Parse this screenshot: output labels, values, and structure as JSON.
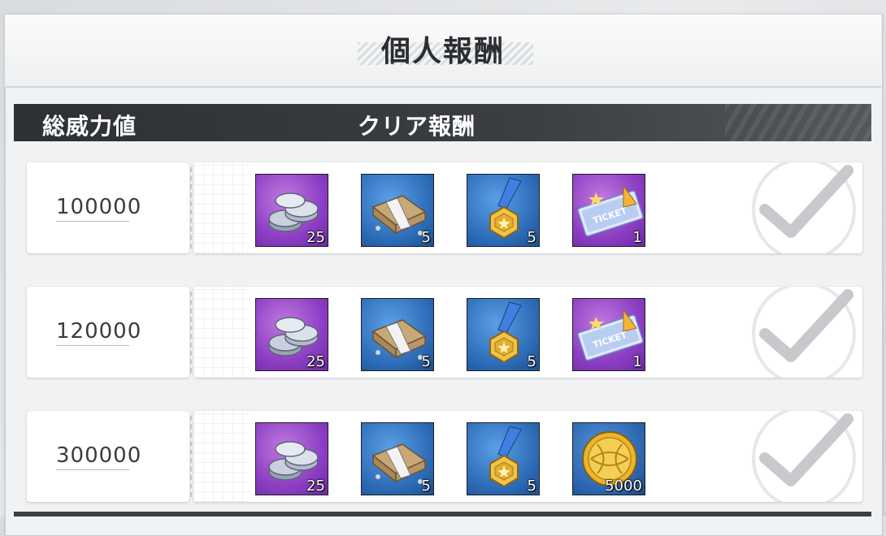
{
  "title": "個人報酬",
  "header": {
    "power_label": "総威力値",
    "reward_label": "クリア報酬"
  },
  "rows": [
    {
      "power": "100000",
      "rewards": [
        {
          "icon": "silver-coins-icon",
          "qty": "25",
          "bg": "purple"
        },
        {
          "icon": "cash-bundle-icon",
          "qty": "5",
          "bg": "blue"
        },
        {
          "icon": "gold-medal-icon",
          "qty": "5",
          "bg": "blue"
        },
        {
          "icon": "ticket-icon",
          "qty": "1",
          "bg": "purple"
        }
      ],
      "claimed": true
    },
    {
      "power": "120000",
      "rewards": [
        {
          "icon": "silver-coins-icon",
          "qty": "25",
          "bg": "purple"
        },
        {
          "icon": "cash-bundle-icon",
          "qty": "5",
          "bg": "blue"
        },
        {
          "icon": "gold-medal-icon",
          "qty": "5",
          "bg": "blue"
        },
        {
          "icon": "ticket-icon",
          "qty": "1",
          "bg": "purple"
        }
      ],
      "claimed": true
    },
    {
      "power": "300000",
      "rewards": [
        {
          "icon": "silver-coins-icon",
          "qty": "25",
          "bg": "purple"
        },
        {
          "icon": "cash-bundle-icon",
          "qty": "5",
          "bg": "blue"
        },
        {
          "icon": "gold-medal-icon",
          "qty": "5",
          "bg": "blue"
        },
        {
          "icon": "gold-coin-icon",
          "qty": "5000",
          "bg": "blue"
        }
      ],
      "claimed": true
    }
  ],
  "colors": {
    "header_bg": "#2d3034",
    "purple_tile": "#8d3fc4",
    "blue_tile": "#2c6bb6",
    "check": "#c9cbce"
  }
}
